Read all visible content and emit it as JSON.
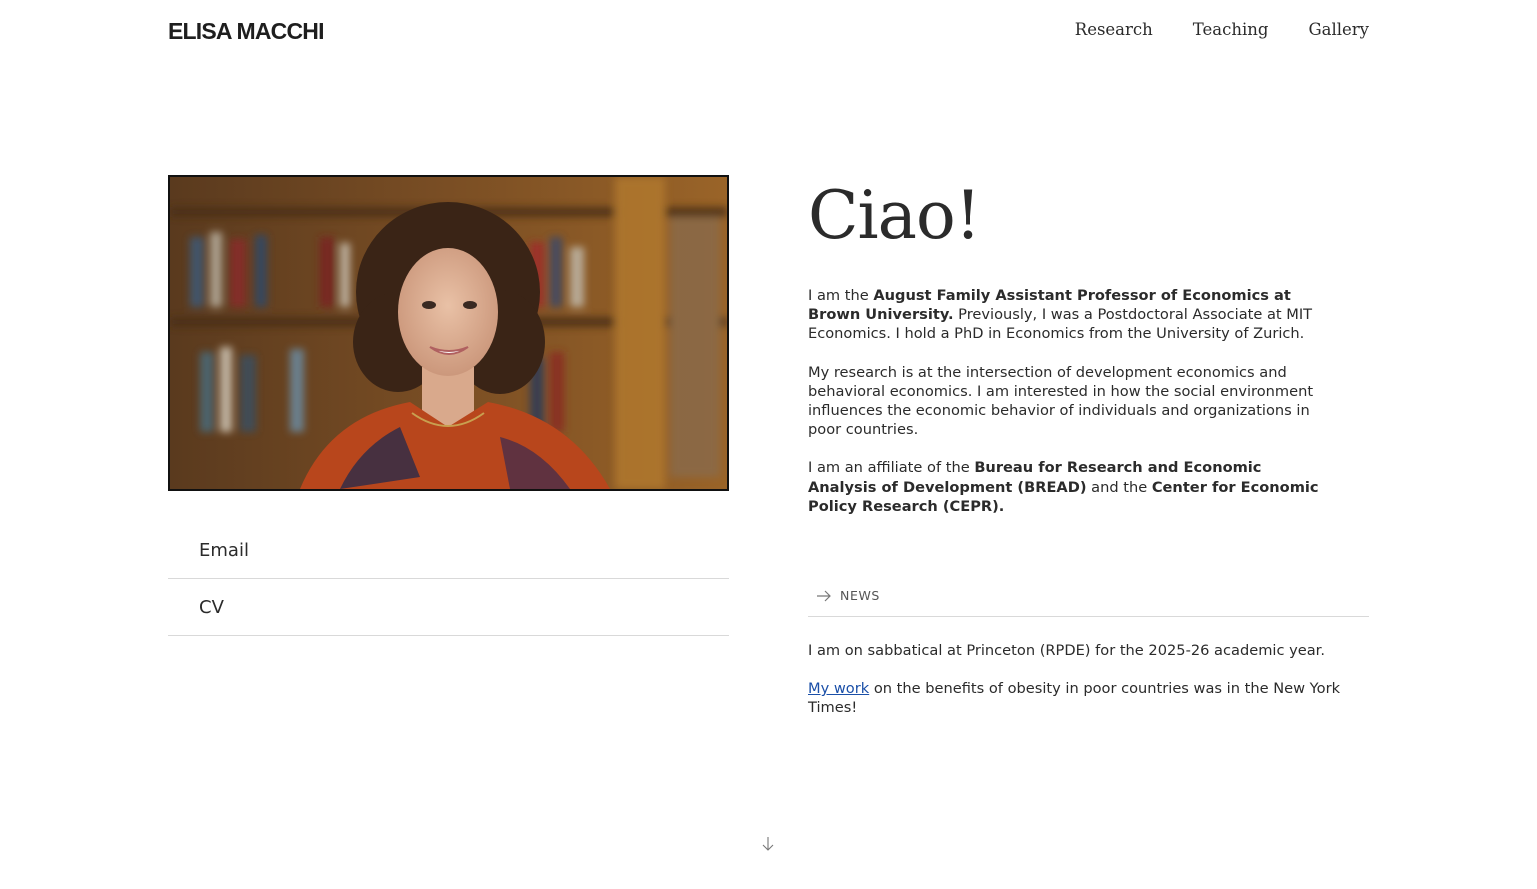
{
  "header": {
    "site_title": "ELISA MACCHI",
    "nav": [
      "Research",
      "Teaching",
      "Gallery"
    ]
  },
  "contact": {
    "email_label": "Email",
    "cv_label": "CV"
  },
  "main": {
    "greeting": "Ciao!",
    "bio": {
      "p1_pre": "I am the ",
      "p1_bold": "August Family Assistant Professor of Economics at Brown University.",
      "p1_post": " Previously, I was a Postdoctoral Associate at MIT Economics. I hold a PhD in Economics from the University of Zurich.",
      "p2": "My research is at the intersection of development economics and behavioral economics. I am interested in how the social environment influences the economic behavior of individuals and organizations in poor countries.",
      "p3_pre": "I am an affiliate of the ",
      "p3_bold1": "Bureau for Research and Economic Analysis of Development (BREAD)",
      "p3_mid": " and the ",
      "p3_bold2": "Center for Economic Policy Research (CEPR)."
    }
  },
  "news": {
    "label": "NEWS",
    "item1": "I am on sabbatical at Princeton (RPDE) for the 2025-26 academic year.",
    "item2_link": "My work",
    "item2_rest": " on the benefits of obesity in poor countries was in the New York Times!"
  },
  "icons": {
    "news_arrow": "arrow-right-icon",
    "scroll_down": "arrow-down-icon"
  },
  "colors": {
    "text": "#2b2b2b",
    "link": "#1a4fa8",
    "divider": "#d9d9d9"
  }
}
